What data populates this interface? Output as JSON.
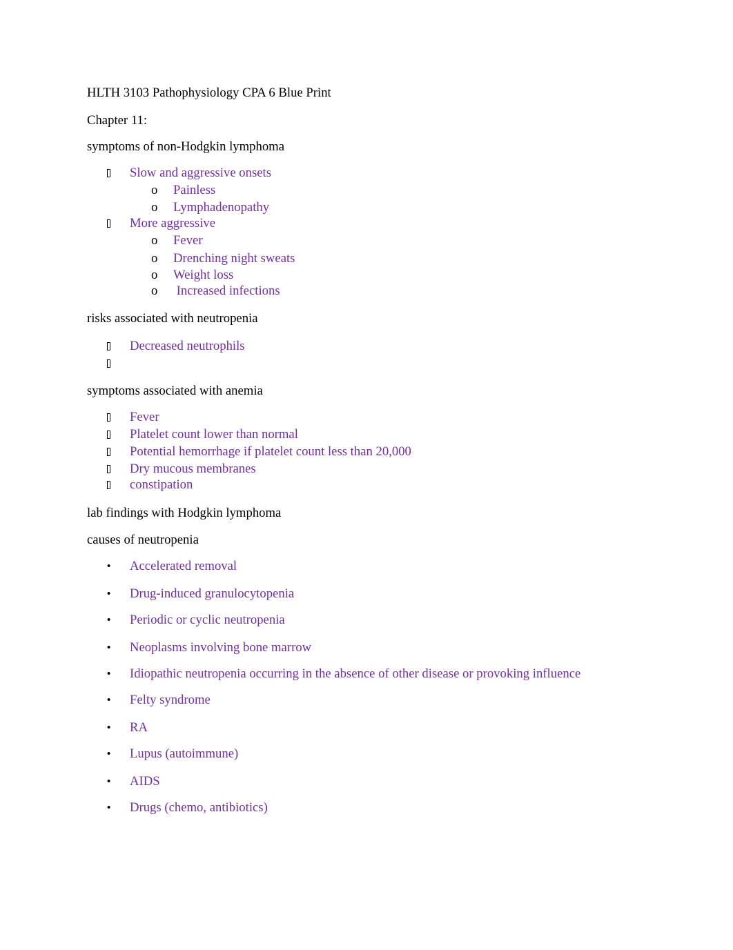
{
  "document": {
    "title": "HLTH 3103 Pathophysiology CPA 6 Blue Print",
    "chapter": "Chapter 11:",
    "accent_color": "#7030A0",
    "sections": [
      {
        "heading": "symptoms of non-Hodgkin lymphoma",
        "items": [
          {
            "bullet_icon": "missing-glyph-box",
            "text": "Slow and aggressive onsets",
            "subitems": [
              {
                "bullet": "o",
                "text": "Painless"
              },
              {
                "bullet": "o",
                "text": "Lymphadenopathy"
              }
            ]
          },
          {
            "bullet_icon": "missing-glyph-box",
            "text": "More aggressive",
            "subitems": [
              {
                "bullet": "o",
                "text": "Fever"
              },
              {
                "bullet": "o",
                "text": "Drenching night sweats"
              },
              {
                "bullet": "o",
                "text": "Weight loss"
              },
              {
                "bullet": "o",
                "text": " Increased infections"
              }
            ]
          }
        ]
      },
      {
        "heading": "risks associated with neutropenia",
        "items": [
          {
            "bullet_icon": "missing-glyph-box",
            "text": "Decreased neutrophils"
          },
          {
            "bullet_icon": "missing-glyph-box",
            "text": ""
          }
        ]
      },
      {
        "heading": "symptoms associated with anemia",
        "items": [
          {
            "bullet_icon": "missing-glyph-box",
            "text": "Fever"
          },
          {
            "bullet_icon": "missing-glyph-box",
            "text": "Platelet count lower than normal"
          },
          {
            "bullet_icon": "missing-glyph-box",
            "text": "Potential hemorrhage if platelet count less than 20,000"
          },
          {
            "bullet_icon": "missing-glyph-box",
            "text": "Dry mucous membranes"
          },
          {
            "bullet_icon": "missing-glyph-box",
            "text": "constipation"
          }
        ]
      },
      {
        "heading": "lab findings with Hodgkin lymphoma",
        "items": []
      },
      {
        "heading": "causes of neutropenia",
        "items": [
          {
            "bullet": "•",
            "text": "Accelerated removal"
          },
          {
            "bullet": "•",
            "text": "Drug-induced granulocytopenia"
          },
          {
            "bullet": "•",
            "text": "Periodic or cyclic neutropenia"
          },
          {
            "bullet": "•",
            "text": "Neoplasms involving bone marrow"
          },
          {
            "bullet": "•",
            "text": "Idiopathic neutropenia occurring in the absence of other disease or provoking influence"
          },
          {
            "bullet": "•",
            "text": "Felty syndrome"
          },
          {
            "bullet": "•",
            "text": "RA"
          },
          {
            "bullet": "•",
            "text": "Lupus (autoimmune)"
          },
          {
            "bullet": "•",
            "text": "AIDS"
          },
          {
            "bullet": "•",
            "text": "Drugs (chemo, antibiotics)"
          }
        ]
      }
    ]
  }
}
